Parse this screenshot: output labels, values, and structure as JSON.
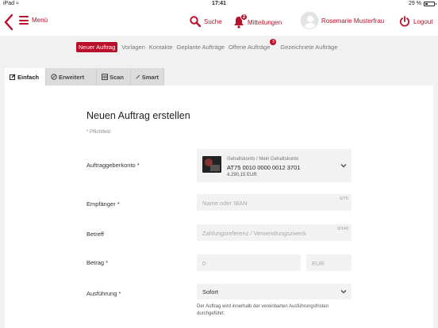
{
  "status_bar": {
    "device": "iPad",
    "time": "17:41",
    "battery": "29 %"
  },
  "topbar": {
    "menu_label": "Menü",
    "search_label": "Suche",
    "messages_label": "Mitteilungen",
    "messages_badge": "2",
    "user_name": "Rosemarie Musterfrau",
    "logout_label": "Logout"
  },
  "subnav": {
    "items": [
      "Neuer Auftrag",
      "Vorlagen",
      "Kontakte",
      "Geplante Aufträge",
      "Offene Aufträge",
      "Gezeichnete Aufträge"
    ],
    "active_index": 0,
    "open_orders_badge": "3"
  },
  "tabs": [
    {
      "label": "Einfach",
      "icon": "edit-icon",
      "active": true
    },
    {
      "label": "Erweitert",
      "icon": "pen-icon",
      "active": false
    },
    {
      "label": "Scan",
      "icon": "scan-icon",
      "active": false
    },
    {
      "label": "Smart",
      "icon": "wand-icon",
      "active": false
    }
  ],
  "form": {
    "title": "Neuen Auftrag erstellen",
    "required_note": "* Pflichtfeld",
    "account": {
      "label": "Auftraggeberkonto *",
      "name": "Gehaltskonto / Mein Gehaltskonto",
      "iban": "AT75 0010 0000 0012 3701",
      "balance": "4.290,15 EUR"
    },
    "recipient": {
      "label": "Empfänger *",
      "placeholder": "Name oder IBAN",
      "counter": "0/70"
    },
    "reference": {
      "label": "Betreff",
      "placeholder": "Zahlungsreferenz / Verwendungszweck",
      "counter": "0/140"
    },
    "amount": {
      "label": "Betrag *",
      "placeholder": "0",
      "currency": "EUR"
    },
    "execution": {
      "label": "Ausführung *",
      "value": "Sofort",
      "note": "Der Auftrag wird innerhalb der vereinbarten Ausführungsfristen durchgeführt."
    }
  },
  "colors": {
    "accent": "#b8102a",
    "field_bg": "#f2f2f2",
    "page_bg": "#f1f1f1"
  }
}
